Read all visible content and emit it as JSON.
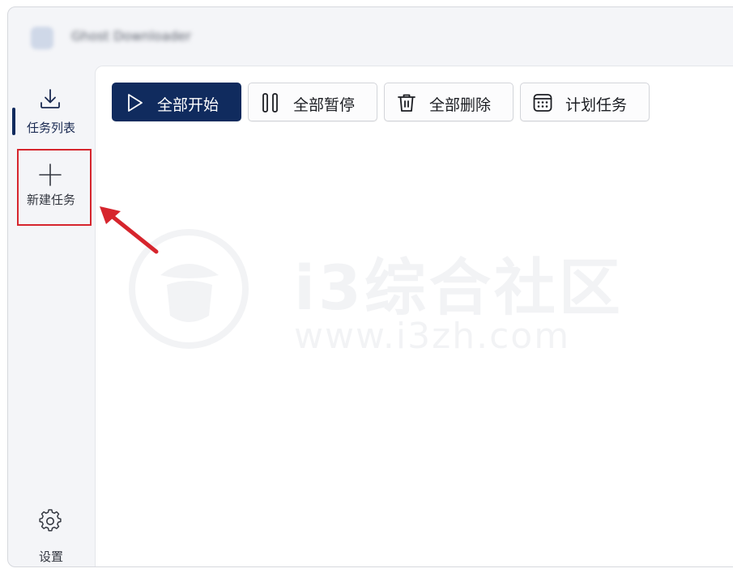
{
  "window": {
    "title": "Ghost Downloader"
  },
  "sidebar": {
    "items": [
      {
        "label": "任务列表",
        "icon": "download-icon",
        "active": true
      },
      {
        "label": "新建任务",
        "icon": "plus-icon",
        "active": false
      }
    ],
    "settings": {
      "label": "设置",
      "icon": "gear-icon"
    }
  },
  "toolbar": {
    "start_all": "全部开始",
    "pause_all": "全部暂停",
    "delete_all": "全部删除",
    "schedule": "计划任务"
  },
  "watermark": {
    "text": "i3综合社区",
    "url": "www.i3zh.com"
  },
  "colors": {
    "accent": "#102b5e",
    "annotation": "#d6252d"
  }
}
